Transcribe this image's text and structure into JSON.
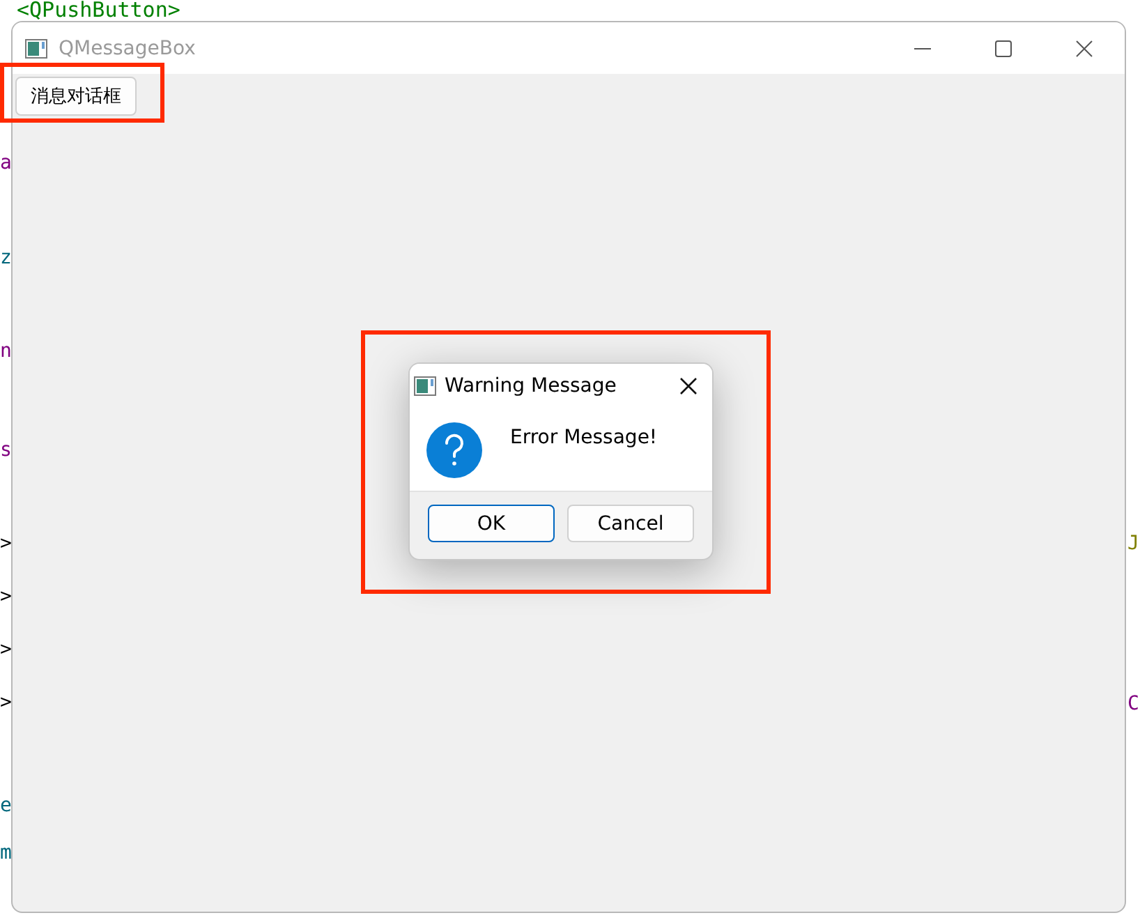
{
  "background_editor": {
    "fragments": [
      {
        "text": "<QPushButton>",
        "color": "#008000"
      },
      {
        "text": "a",
        "color": "#800080"
      },
      {
        "text": "z",
        "color": "#00677c"
      },
      {
        "text": "n",
        "color": "#800080"
      },
      {
        "text": "s",
        "color": "#800080"
      },
      {
        "text": ">",
        "color": "#000000"
      },
      {
        "text": ">",
        "color": "#000000"
      },
      {
        "text": ">",
        "color": "#000000"
      },
      {
        "text": ">",
        "color": "#000000"
      },
      {
        "text": "e",
        "color": "#00677c"
      },
      {
        "text": "m",
        "color": "#00677c"
      },
      {
        "text": "J",
        "color": "#808000"
      },
      {
        "text": "C",
        "color": "#800080"
      }
    ]
  },
  "window": {
    "title": "QMessageBox",
    "button": "消息对话框"
  },
  "dialog": {
    "title": "Warning Message",
    "message": "Error Message!",
    "buttons": [
      {
        "label": "OK",
        "selected": true
      },
      {
        "label": "Cancel",
        "selected": false
      }
    ]
  },
  "annotations": [
    {
      "kind": "highlight",
      "color": "#ff2a00"
    },
    {
      "kind": "highlight",
      "color": "#ff2a00"
    }
  ]
}
